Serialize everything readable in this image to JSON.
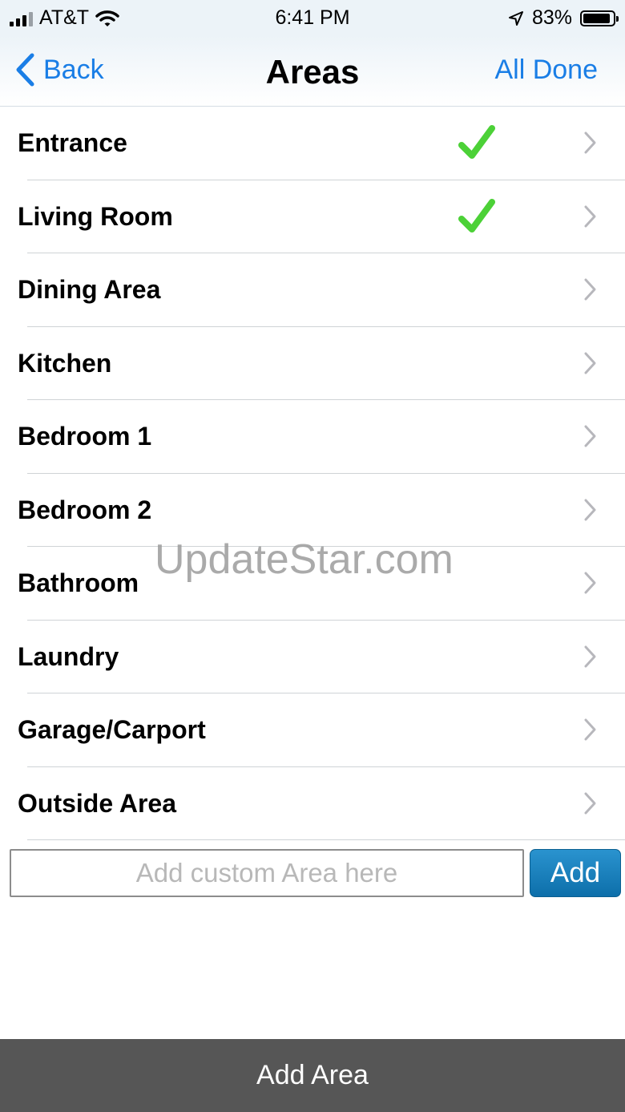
{
  "status_bar": {
    "carrier": "AT&T",
    "time": "6:41 PM",
    "battery": "83%"
  },
  "nav": {
    "back_label": "Back",
    "title": "Areas",
    "all_done_label": "All Done"
  },
  "areas": [
    {
      "label": "Entrance",
      "done": true
    },
    {
      "label": "Living Room",
      "done": true
    },
    {
      "label": "Dining Area",
      "done": false
    },
    {
      "label": "Kitchen",
      "done": false
    },
    {
      "label": "Bedroom 1",
      "done": false
    },
    {
      "label": "Bedroom 2",
      "done": false
    },
    {
      "label": "Bathroom",
      "done": false
    },
    {
      "label": "Laundry",
      "done": false
    },
    {
      "label": "Garage/Carport",
      "done": false
    },
    {
      "label": "Outside Area",
      "done": false
    }
  ],
  "custom_area": {
    "placeholder": "Add custom Area here",
    "value": "",
    "add_label": "Add"
  },
  "bottom_button": {
    "label": "Add Area"
  },
  "watermark": "UpdateStar.com",
  "colors": {
    "accent": "#1a7ee6",
    "check": "#4cd137",
    "add_button": "#1a7fbd",
    "bottom_bar": "#565656"
  },
  "icons": {
    "done": "checkmark-icon",
    "row": "chevron-right-icon",
    "back": "chevron-left-icon"
  }
}
